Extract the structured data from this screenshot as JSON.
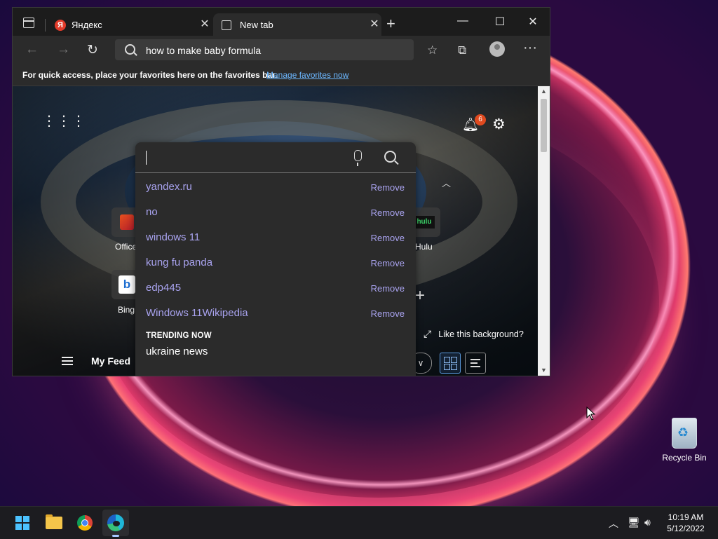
{
  "browser": {
    "tabs": [
      {
        "label": "Яндекс",
        "icon": "yandex-icon"
      },
      {
        "label": "New tab",
        "icon": "page-icon",
        "active": true
      }
    ],
    "address": "how to make baby formula",
    "favorites_bar": {
      "message": "For quick access, place your favorites here on the favorites bar.",
      "link": "Manage favorites now"
    }
  },
  "newtab": {
    "notification_count": "6",
    "quick_links": [
      {
        "label": "Office",
        "icon": "office-icon"
      },
      {
        "label": "Hulu",
        "icon": "hulu-icon"
      },
      {
        "label": "Bing",
        "icon": "bing-icon"
      }
    ],
    "like_background": "Like this background?",
    "my_feed": "My Feed"
  },
  "search_dropdown": {
    "history": [
      {
        "query": "yandex.ru",
        "action": "Remove"
      },
      {
        "query": "no",
        "action": "Remove"
      },
      {
        "query": "windows 11",
        "action": "Remove"
      },
      {
        "query": "kung fu panda",
        "action": "Remove"
      },
      {
        "query": "edp445",
        "action": "Remove"
      },
      {
        "query": "Windows 11Wikipedia",
        "action": "Remove"
      }
    ],
    "trending_header": "TRENDING NOW",
    "trending": [
      "ukraine news"
    ]
  },
  "desktop": {
    "recycle_bin": "Recycle Bin"
  },
  "taskbar": {
    "apps": [
      "windows-start-icon",
      "file-explorer-icon",
      "chrome-icon",
      "edge-icon"
    ],
    "time": "10:19 AM",
    "date": "5/12/2022"
  },
  "colors": {
    "accent": "#4cc2ff",
    "history_text": "#a9a3ef",
    "link": "#6cb7ff",
    "notification_badge": "#e04a1f"
  }
}
